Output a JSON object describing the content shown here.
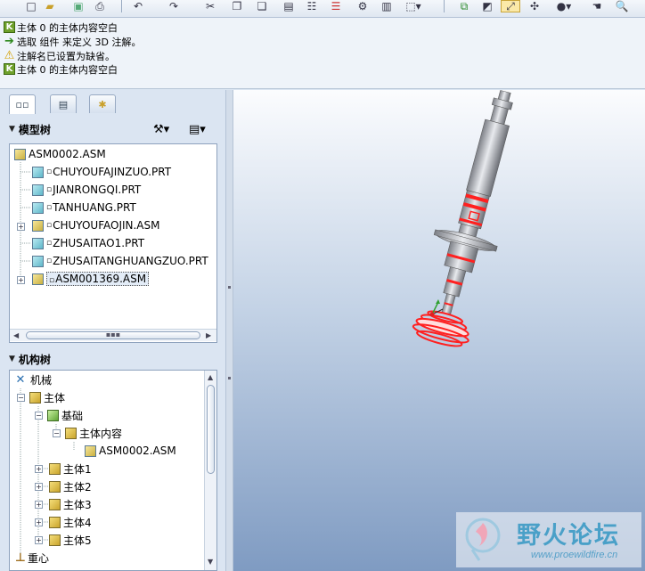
{
  "messages": [
    {
      "icon": "nav-icon",
      "text": "主体 0 的主体内容空白"
    },
    {
      "icon": "green-arrow-icon",
      "text": "选取 组件 来定义 3D 注解。"
    },
    {
      "icon": "warning-icon",
      "text": "注解名已设置为缺省。"
    },
    {
      "icon": "nav-icon",
      "text": "主体 0 的主体内容空白"
    }
  ],
  "panel_tabs": [
    {
      "name": "model-tree-tab-icon",
      "active": true
    },
    {
      "name": "folder-browser-tab-icon",
      "active": false
    },
    {
      "name": "favorites-tab-icon",
      "active": false
    }
  ],
  "model_tree": {
    "title": "模型树",
    "root": "ASM0002.ASM",
    "items": [
      {
        "label": "CHUYOUFAJINZUO.PRT",
        "type": "prt",
        "expandable": false,
        "selected": false
      },
      {
        "label": "JIANRONGQI.PRT",
        "type": "prt",
        "expandable": false,
        "selected": false
      },
      {
        "label": "TANHUANG.PRT",
        "type": "prt",
        "expandable": false,
        "selected": false
      },
      {
        "label": "CHUYOUFAOJIN.ASM",
        "type": "asm",
        "expandable": true,
        "selected": false
      },
      {
        "label": "ZHUSAITAO1.PRT",
        "type": "prt",
        "expandable": false,
        "selected": false
      },
      {
        "label": "ZHUSAITANGHUANGZUO.PRT",
        "type": "prt",
        "expandable": false,
        "selected": false
      },
      {
        "label": "ASM001369.ASM",
        "type": "asm",
        "expandable": true,
        "selected": true
      }
    ]
  },
  "mech_tree": {
    "title": "机构树",
    "items": [
      {
        "label": "机械",
        "level": 0,
        "icon": "mechanism-icon"
      },
      {
        "label": "主体",
        "level": 1,
        "icon": "bodies-icon"
      },
      {
        "label": "基础",
        "level": 2,
        "icon": "ground-body-icon"
      },
      {
        "label": "主体内容",
        "level": 3,
        "icon": "body-content-icon"
      },
      {
        "label": "ASM0002.ASM",
        "level": 4,
        "icon": "assembly-icon"
      },
      {
        "label": "主体1",
        "level": 2,
        "icon": "body-icon"
      },
      {
        "label": "主体2",
        "level": 2,
        "icon": "body-icon"
      },
      {
        "label": "主体3",
        "level": 2,
        "icon": "body-icon"
      },
      {
        "label": "主体4",
        "level": 2,
        "icon": "body-icon"
      },
      {
        "label": "主体5",
        "level": 2,
        "icon": "body-icon"
      },
      {
        "label": "重心",
        "level": 0,
        "icon": "center-of-gravity-icon"
      }
    ]
  },
  "watermark": {
    "title": "野火论坛",
    "url": "www.proewildfire.cn"
  },
  "colors": {
    "highlight": "#ff2020",
    "viewport_top": "#fbfcfe",
    "viewport_bottom": "#7f9bc2"
  }
}
